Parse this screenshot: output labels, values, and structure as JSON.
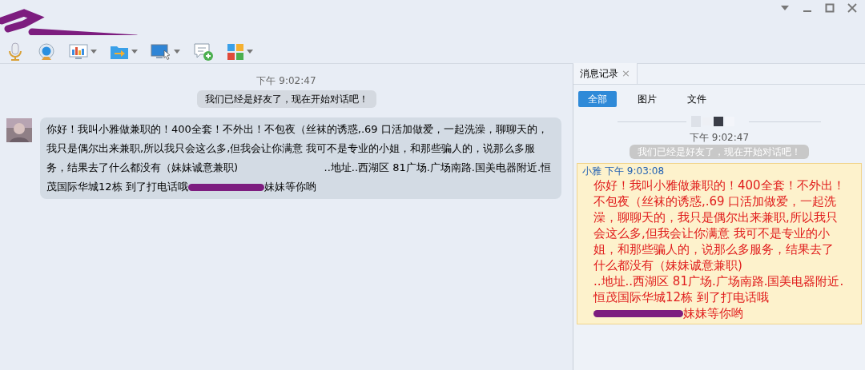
{
  "toolbar": [
    {
      "dropdown": false
    },
    {
      "dropdown": false
    },
    {
      "dropdown": true
    },
    {
      "dropdown": true
    },
    {
      "dropdown": true
    },
    {
      "dropdown": false
    },
    {
      "dropdown": true
    }
  ],
  "chat": {
    "time": "下午 9:02:47",
    "notice": "我们已经是好友了，现在开始对话吧！",
    "messages": [
      {
        "text": "你好！我叫小雅做兼职的！400全套！不外出！不包夜（丝袜的诱惑,.69 口活加做爱，一起洗澡，聊聊天的，我只是偶尔出来兼职,所以我只会这么多,但我会让你满意 我可不是专业的小姐，和那些骗人的，说那么多服务，结果去了什么都没有（妹妹诚意兼职)                          ..地址..西湖区 81广场.广场南路.国美电器附近.恒茂国际华城12栋 到了打电话哦",
        "text_after": "妹妹等你哟"
      }
    ]
  },
  "history": {
    "tab": {
      "label": "消息记录",
      "close": "×"
    },
    "filters": [
      {
        "label": "全部",
        "selected": true
      },
      {
        "label": "图片",
        "selected": false
      },
      {
        "label": "文件",
        "selected": false
      }
    ],
    "time": "下午 9:02:47",
    "notice": "我们已经是好友了，现在开始对话吧！",
    "entries": [
      {
        "sender": "小雅",
        "time": "下午 9:03:08",
        "text": "你好！我叫小雅做兼职的！400全套！不外出！不包夜（丝袜的诱惑,.69 口活加做爱，一起洗澡，聊聊天的，我只是偶尔出来兼职,所以我只会这么多,但我会让你满意 我可不是专业的小姐，和那些骗人的，说那么多服务，结果去了什么都没有（妹妹诚意兼职)                          ..地址..西湖区 81广场.广场南路.国美电器附近.恒茂国际华城12栋 到了打电话哦",
        "text_after": "妹妹等你哟"
      }
    ]
  }
}
